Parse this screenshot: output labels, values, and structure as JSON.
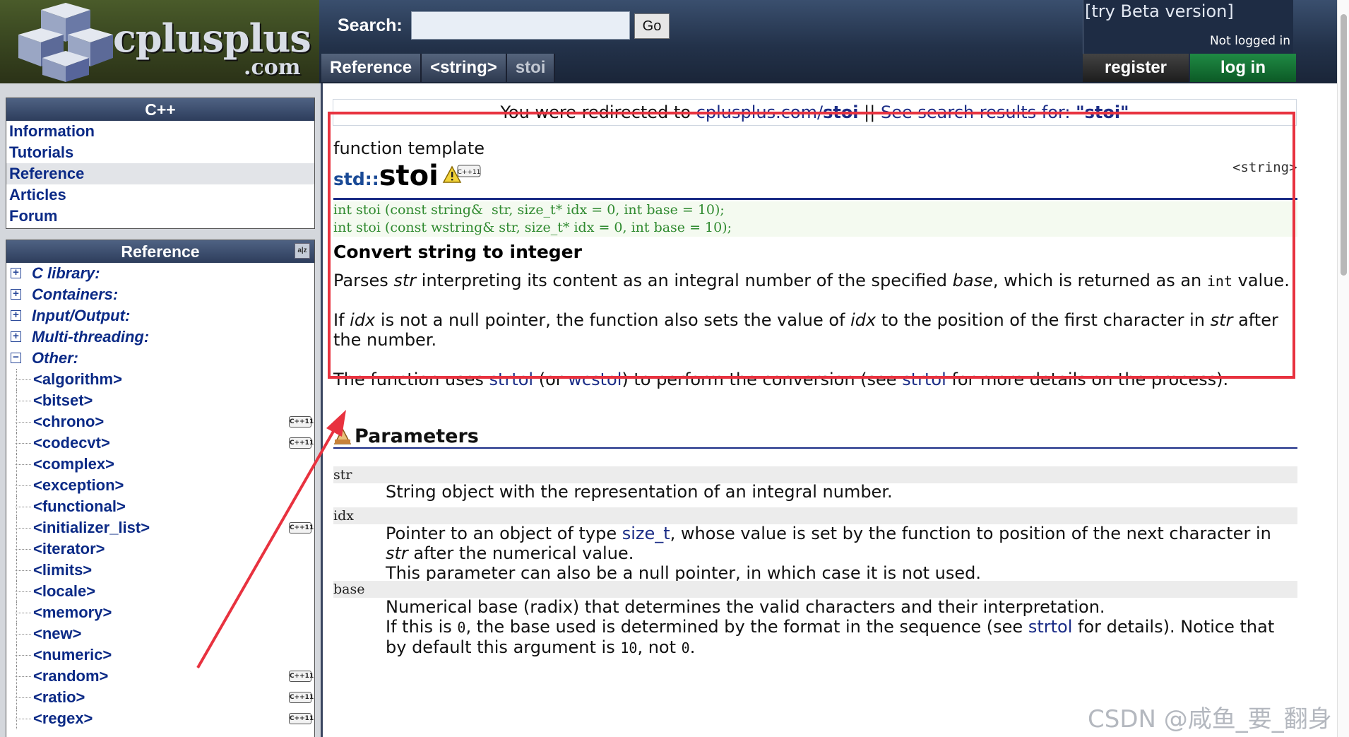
{
  "header": {
    "logo_text": "cplusplus",
    "logo_domain": ".com",
    "search_label": "Search:",
    "search_value": "",
    "go_label": "Go",
    "beta_link": "[try Beta version]",
    "login_status": "Not logged in",
    "breadcrumbs": [
      "Reference",
      "<string>",
      "stoi"
    ],
    "register_label": "register",
    "login_label": "log in"
  },
  "sidebar": {
    "cpp_title": "C++",
    "cpp_items": [
      "Information",
      "Tutorials",
      "Reference",
      "Articles",
      "Forum"
    ],
    "active_item": "Reference",
    "ref_title": "Reference",
    "ref_icon": "a-z-sort-icon",
    "categories": [
      "C library:",
      "Containers:",
      "Input/Output:",
      "Multi-threading:",
      "Other:"
    ],
    "other_headers": [
      {
        "name": "<algorithm>",
        "cpp11": ""
      },
      {
        "name": "<bitset>",
        "cpp11": ""
      },
      {
        "name": "<chrono>",
        "cpp11": "C++11"
      },
      {
        "name": "<codecvt>",
        "cpp11": "C++11"
      },
      {
        "name": "<complex>",
        "cpp11": ""
      },
      {
        "name": "<exception>",
        "cpp11": ""
      },
      {
        "name": "<functional>",
        "cpp11": ""
      },
      {
        "name": "<initializer_list>",
        "cpp11": "C++11"
      },
      {
        "name": "<iterator>",
        "cpp11": ""
      },
      {
        "name": "<limits>",
        "cpp11": ""
      },
      {
        "name": "<locale>",
        "cpp11": ""
      },
      {
        "name": "<memory>",
        "cpp11": ""
      },
      {
        "name": "<new>",
        "cpp11": ""
      },
      {
        "name": "<numeric>",
        "cpp11": ""
      },
      {
        "name": "<random>",
        "cpp11": "C++11"
      },
      {
        "name": "<ratio>",
        "cpp11": "C++11"
      },
      {
        "name": "<regex>",
        "cpp11": "C++11"
      }
    ]
  },
  "main": {
    "redirect_prefix": "You were redirected to ",
    "redirect_domain": "cplusplus.com/",
    "redirect_name": "stoi",
    "redirect_sep": " || ",
    "search_results_label": "See search results for: ",
    "search_results_query": "\"stoi\"",
    "func_kind": "function template",
    "func_ns": "std::",
    "func_name": "stoi",
    "cpp11_badge": "C++11",
    "header_ref": "<string>",
    "prototypes": [
      "int stoi (const string&  str, size_t* idx = 0, int base = 10);",
      "int stoi (const wstring& str, size_t* idx = 0, int base = 10);"
    ],
    "short_desc": "Convert string to integer",
    "para1": {
      "a": "Parses ",
      "b": "str",
      "c": " interpreting its content as an integral number of the specified ",
      "d": "base",
      "e": ", which is returned as an ",
      "f": "int",
      "g": " value."
    },
    "para2": {
      "a": "If ",
      "b": "idx",
      "c": " is not a null pointer, the function also sets the value of ",
      "d": "idx",
      "e": " to the position of the first character in ",
      "f": "str",
      "g": " after the number."
    },
    "para3": {
      "a": "The function uses ",
      "b": "strtol",
      "c": " (or ",
      "d": "wcstol",
      "e": ") to perform the conversion (see ",
      "f": "strtol",
      "g": " for more details on the process)."
    },
    "params_title": "Parameters",
    "params": {
      "str": {
        "name": "str",
        "desc": "String object with the representation of an integral number."
      },
      "idx": {
        "name": "idx",
        "a": "Pointer to an object of type ",
        "b": "size_t",
        "c": ", whose value is set by the function to position of the next character in ",
        "d": "str",
        "e": " after the numerical value.",
        "f": "This parameter can also be a null pointer, in which case it is not used."
      },
      "base": {
        "name": "base",
        "line1": "Numerical base (radix) that determines the valid characters and their interpretation.",
        "a": "If this is ",
        "b": "0",
        "c": ", the base used is determined by the format in the sequence (see ",
        "d": "strtol",
        "e": " for details). Notice that by default this argument is ",
        "f": "10",
        "g": ", not ",
        "h": "0",
        "i": "."
      }
    }
  },
  "watermark": "CSDN @咸鱼_要_翻身",
  "colors": {
    "highlight": "#e8323f",
    "link": "#1a2c86",
    "proto": "#2f8a2f"
  }
}
